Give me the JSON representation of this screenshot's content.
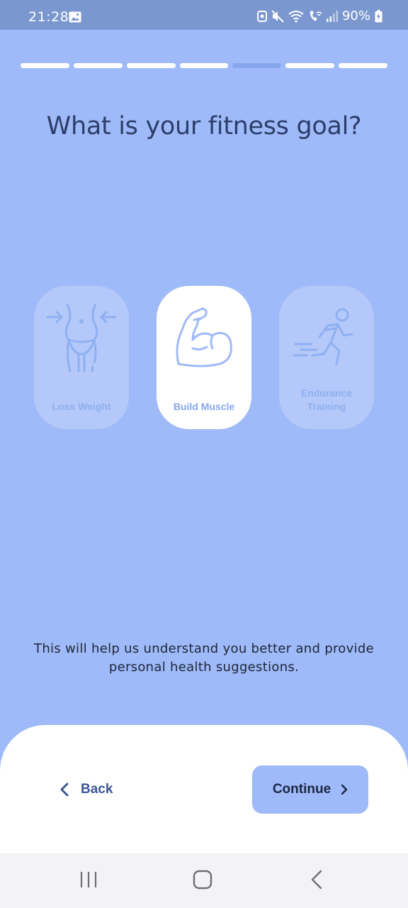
{
  "status_bar": {
    "time": "21:28",
    "battery": "90%",
    "icons": [
      "image-icon",
      "app-notification-icon",
      "mute-icon",
      "wifi-icon",
      "wifi-calling-icon",
      "signal-icon",
      "battery-charging-icon"
    ]
  },
  "progress": {
    "total_steps": 7,
    "current_step": 5
  },
  "title": "What is your fitness goal?",
  "options": [
    {
      "label": "Loss Weight",
      "icon": "waist-icon",
      "selected": false
    },
    {
      "label": "Build Muscle",
      "icon": "flexed-bicep-icon",
      "selected": true
    },
    {
      "label_line1": "Endurance",
      "label_line2": "Training",
      "icon": "running-person-icon",
      "selected": false
    }
  ],
  "helper": {
    "line1": "This will help us understand you better and provide",
    "line2": "personal health suggestions."
  },
  "footer": {
    "back_label": "Back",
    "continue_label": "Continue"
  },
  "colors": {
    "background": "#9fbaf8",
    "accent": "#87a6ee",
    "title": "#2c3e6b",
    "back_text": "#3a5693"
  }
}
